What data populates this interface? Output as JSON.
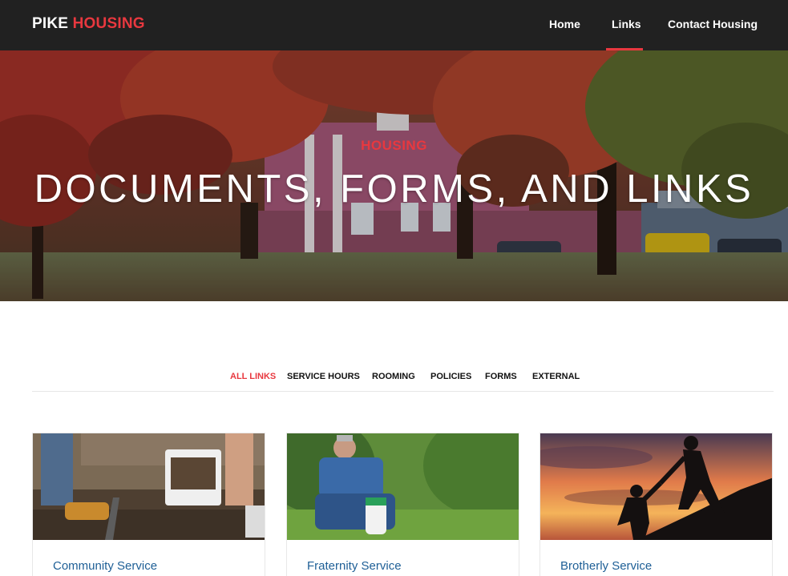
{
  "brand": {
    "part1": "PIKE",
    "part2": "HOUSING"
  },
  "nav": {
    "home": "Home",
    "links": "Links",
    "contact": "Contact Housing",
    "active": "Links"
  },
  "hero": {
    "kicker": "HOUSING",
    "title": "DOCUMENTS, FORMS, AND LINKS"
  },
  "filters": [
    "ALL LINKS",
    "SERVICE HOURS",
    "ROOMING",
    "POLICIES",
    "FORMS",
    "EXTERNAL"
  ],
  "active_filter": "ALL LINKS",
  "cards": [
    {
      "title": "Community Service"
    },
    {
      "title": "Fraternity Service"
    },
    {
      "title": "Brotherly Service"
    }
  ],
  "colors": {
    "accent": "#e8383f",
    "nav_bg": "#212121",
    "card_title": "#1e5f96"
  }
}
